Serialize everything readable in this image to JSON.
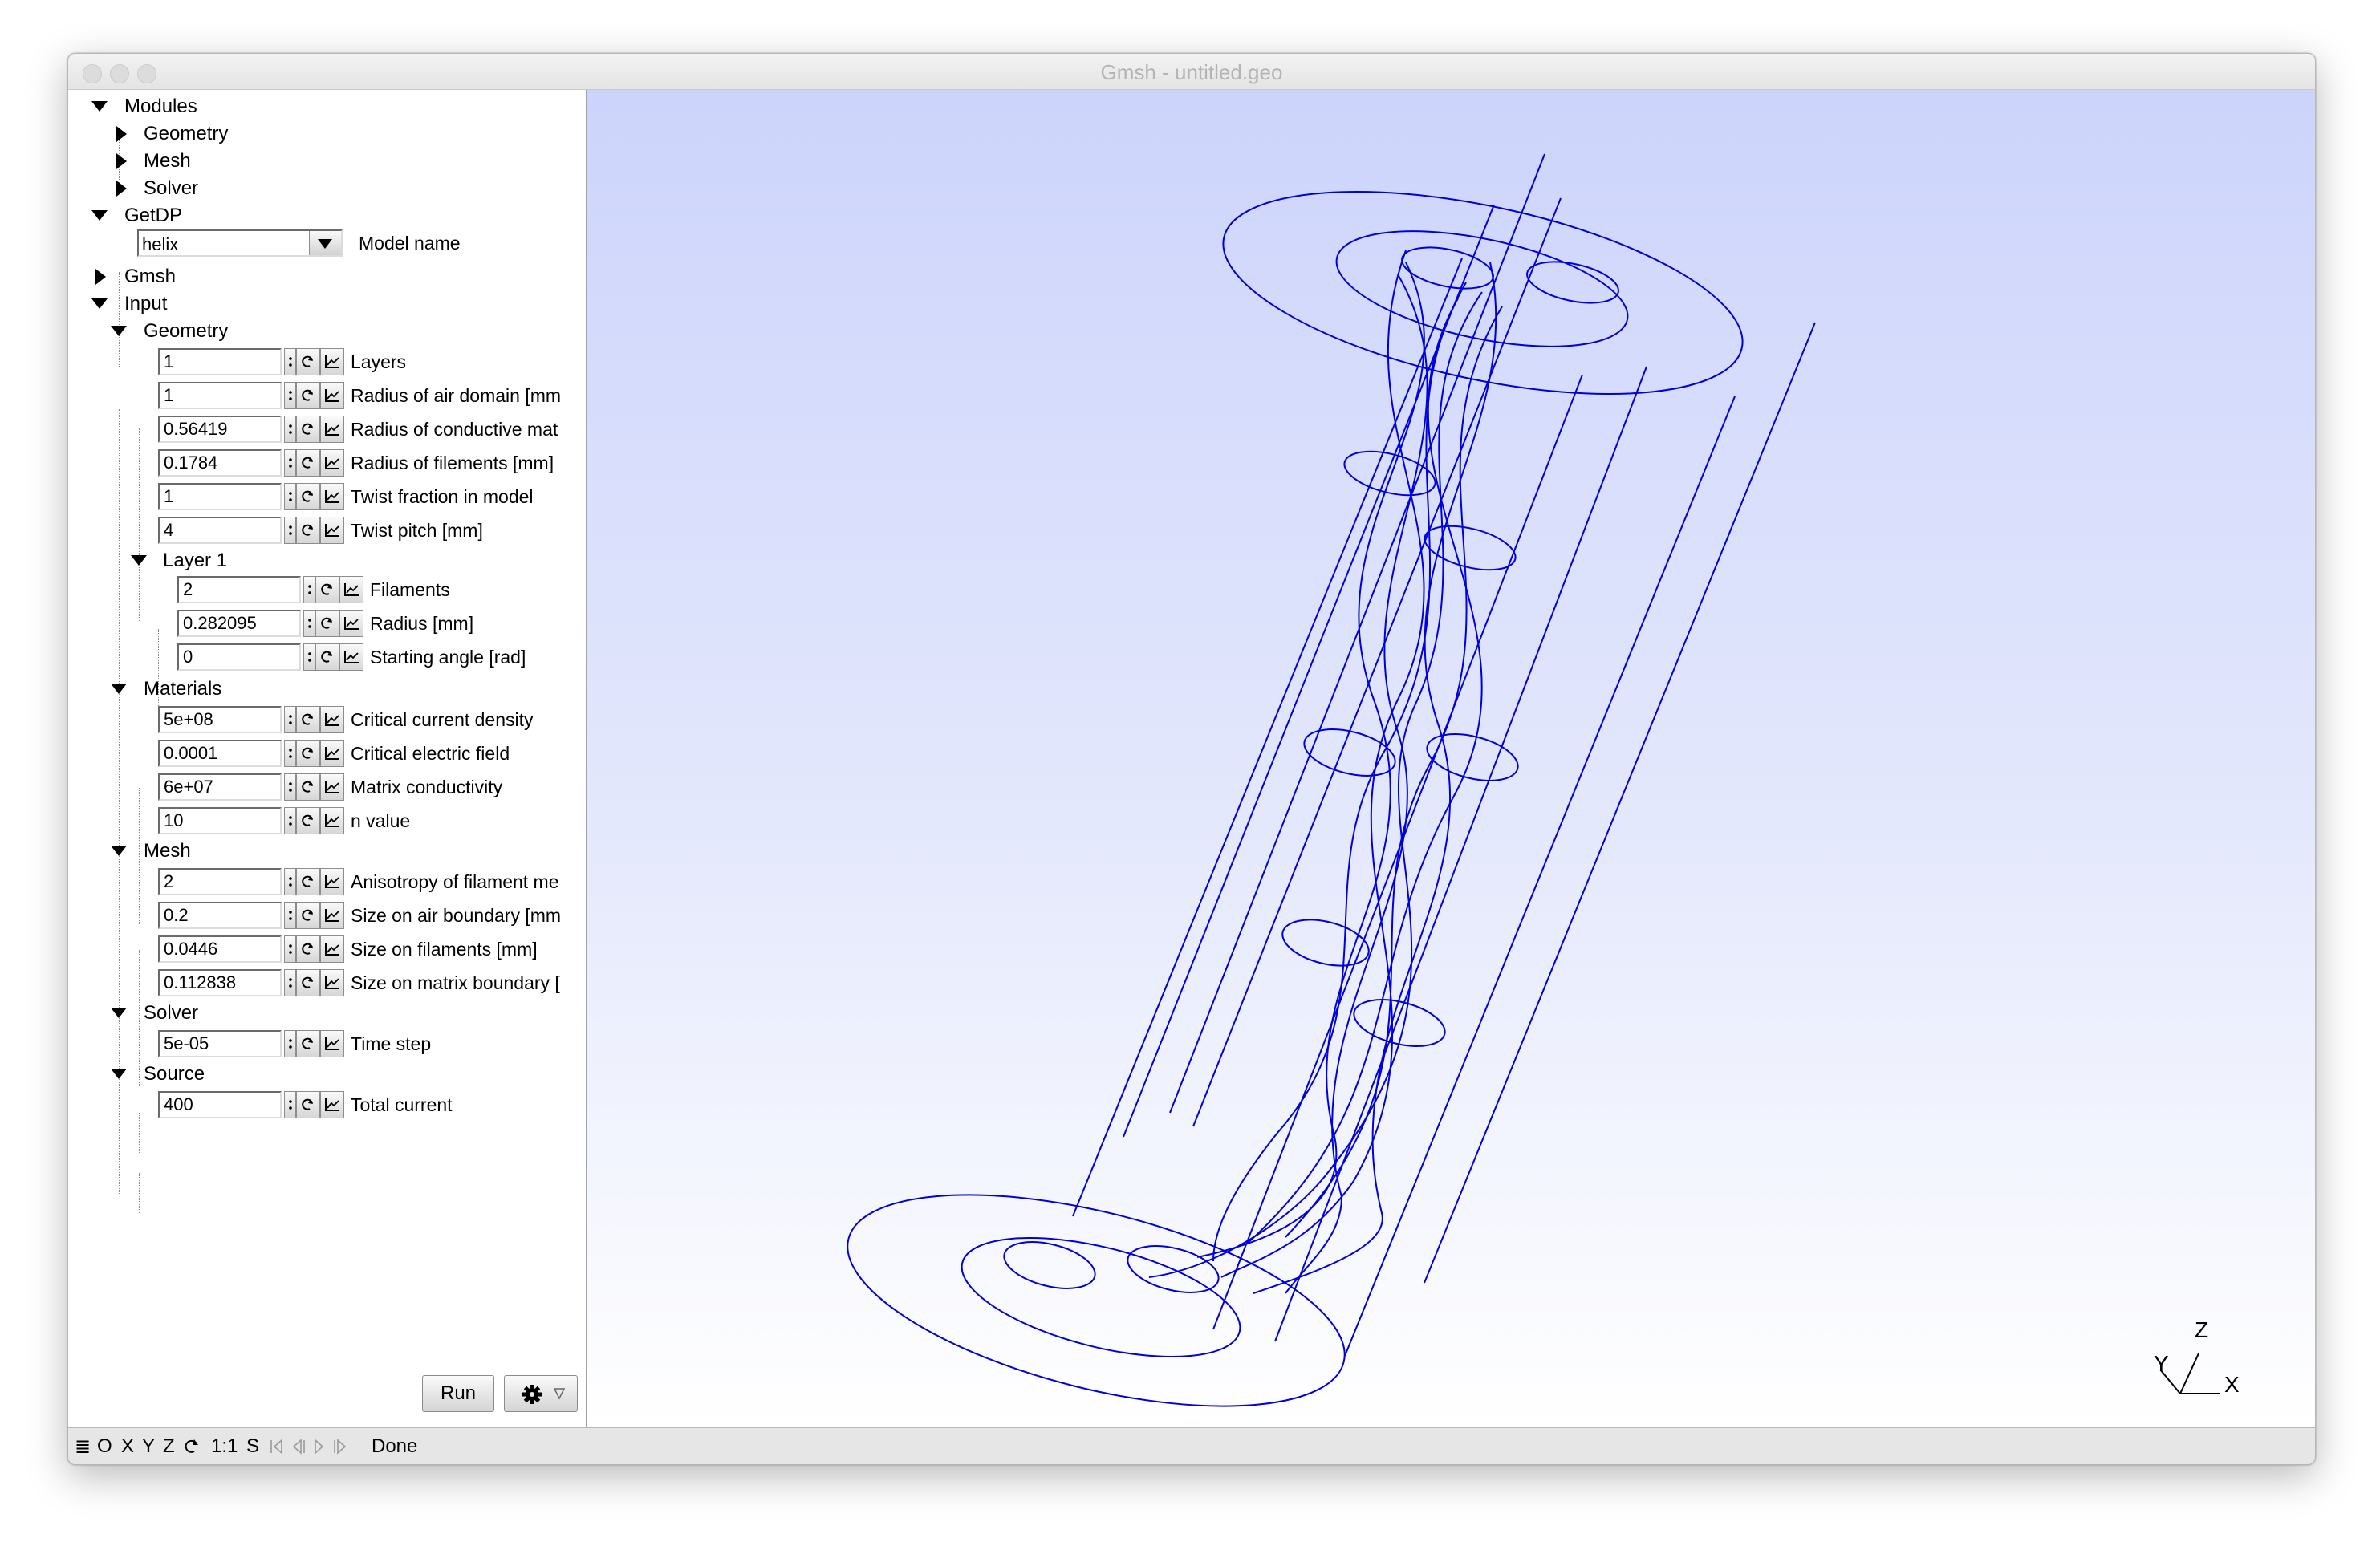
{
  "window": {
    "title": "Gmsh - untitled.geo"
  },
  "tree": {
    "modules": {
      "label": "Modules",
      "children": [
        "Geometry",
        "Mesh",
        "Solver"
      ]
    },
    "getdp": {
      "label": "GetDP",
      "model_value": "helix",
      "model_label": "Model name"
    },
    "gmsh": {
      "label": "Gmsh"
    },
    "input": {
      "label": "Input"
    },
    "groups": {
      "geometry": {
        "label": "Geometry"
      },
      "layer1": {
        "label": "Layer 1"
      },
      "materials": {
        "label": "Materials"
      },
      "mesh": {
        "label": "Mesh"
      },
      "solver": {
        "label": "Solver"
      },
      "source": {
        "label": "Source"
      }
    },
    "params": {
      "layers": {
        "value": "1",
        "label": "Layers"
      },
      "r_air": {
        "value": "1",
        "label": "Radius of air domain [mm"
      },
      "r_cond": {
        "value": "0.56419",
        "label": "Radius of conductive mat"
      },
      "r_fil": {
        "value": "0.1784",
        "label": "Radius of filements [mm]"
      },
      "twist_frac": {
        "value": "1",
        "label": "Twist fraction in model"
      },
      "twist_pitch": {
        "value": "4",
        "label": "Twist pitch [mm]"
      },
      "filaments": {
        "value": "2",
        "label": "Filaments"
      },
      "radius": {
        "value": "0.282095",
        "label": "Radius [mm]"
      },
      "start_angle": {
        "value": "0",
        "label": "Starting angle [rad]"
      },
      "jc": {
        "value": "5e+08",
        "label": "Critical current density"
      },
      "ec": {
        "value": "0.0001",
        "label": "Critical electric field"
      },
      "sigma": {
        "value": "6e+07",
        "label": "Matrix conductivity"
      },
      "n": {
        "value": "10",
        "label": "n value"
      },
      "aniso": {
        "value": "2",
        "label": "Anisotropy of filament me"
      },
      "size_air": {
        "value": "0.2",
        "label": "Size on air boundary [mm"
      },
      "size_fil": {
        "value": "0.0446",
        "label": "Size on filaments [mm]"
      },
      "size_matrix": {
        "value": "0.112838",
        "label": "Size on matrix boundary ["
      },
      "dt": {
        "value": "5e-05",
        "label": "Time step"
      },
      "current": {
        "value": "400",
        "label": "Total current"
      }
    }
  },
  "buttons": {
    "run": "Run"
  },
  "statusbar": {
    "menu_icon": "≣",
    "views": [
      "O",
      "X",
      "Y",
      "Z"
    ],
    "scale": "1:1",
    "select": "S",
    "status": "Done"
  },
  "axes": {
    "y": "Y",
    "z": "Z",
    "x": "X"
  },
  "colors": {
    "geometry_lines": "#0000dd",
    "viewport_top": "#ccd4fb",
    "viewport_bottom": "#ffffff"
  }
}
